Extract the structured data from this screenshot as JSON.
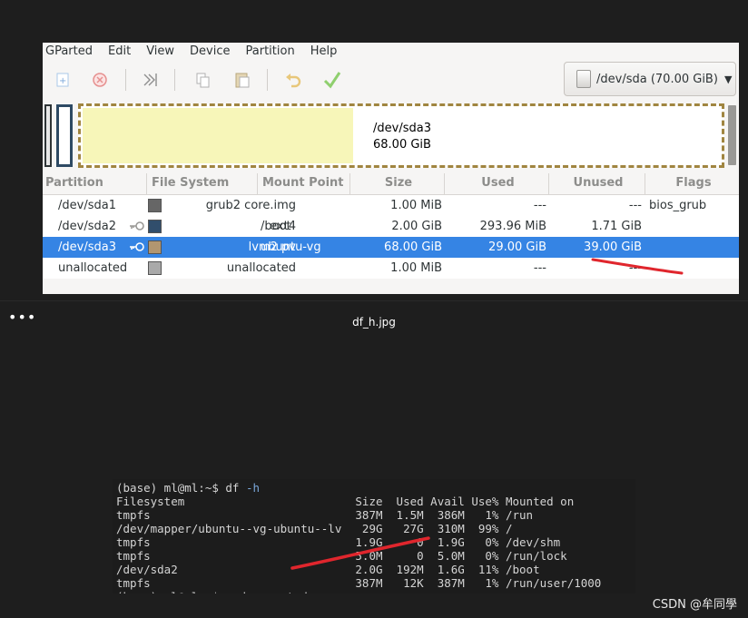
{
  "menu": [
    "GParted",
    "Edit",
    "View",
    "Device",
    "Partition",
    "Help"
  ],
  "toolbar": {
    "new": "new-partition-icon",
    "delete": "delete-icon",
    "resize": "resize-move-icon",
    "copy": "copy-icon",
    "paste": "paste-icon",
    "undo": "undo-icon",
    "apply": "apply-checkmark-icon"
  },
  "device_selector": {
    "label": "/dev/sda (70.00 GiB)",
    "icon": "disk-icon"
  },
  "graph": {
    "name": "/dev/sda3",
    "size": "68.00 GiB",
    "fill_fraction": 0.426
  },
  "table": {
    "headers": [
      "Partition",
      "File System",
      "Mount Point",
      "Size",
      "Used",
      "Unused",
      "Flags"
    ],
    "rows": [
      {
        "partition": "/dev/sda1",
        "fs": "grub2 core.img",
        "mount": "",
        "size": "1.00 MiB",
        "used": "---",
        "unused": "---",
        "flags": "bios_grub",
        "color": "#666666",
        "key": false
      },
      {
        "partition": "/dev/sda2",
        "fs": "ext4",
        "mount": "/boot",
        "size": "2.00 GiB",
        "used": "293.96 MiB",
        "unused": "1.71 GiB",
        "flags": "",
        "color": "#314e6c",
        "key": true
      },
      {
        "partition": "/dev/sda3",
        "fs": "lvm2 pv",
        "mount": "ubuntu-vg",
        "size": "68.00 GiB",
        "used": "29.00 GiB",
        "unused": "39.00 GiB",
        "flags": "",
        "color": "#b29670",
        "key": true
      },
      {
        "partition": "unallocated",
        "fs": "unallocated",
        "mount": "",
        "size": "1.00 MiB",
        "used": "---",
        "unused": "---",
        "flags": "",
        "color": "#a9a9a9",
        "key": false
      }
    ],
    "selected_row": 2
  },
  "viewer": {
    "more": "•••",
    "filename": "df_h.jpg"
  },
  "terminal": {
    "prompt": "(base) ml@ml:~$ df ",
    "flag": "-h",
    "lines": [
      "Filesystem                         Size  Used Avail Use% Mounted on",
      "tmpfs                              387M  1.5M  386M   1% /run",
      "/dev/mapper/ubuntu--vg-ubuntu--lv   29G   27G  310M  99% /",
      "tmpfs                              1.9G     0  1.9G   0% /dev/shm",
      "tmpfs                              5.0M     0  5.0M   0% /run/lock",
      "/dev/sda2                          2.0G  192M  1.6G  11% /boot",
      "tmpfs                              387M   12K  387M   1% /run/user/1000",
      "(base) ml@ml:~$ sudo gparted"
    ]
  },
  "watermark": "CSDN @牟同學",
  "colors": {
    "selection": "#3584e4",
    "annotation": "#e0262d",
    "graph_fill": "#f7f6b9"
  }
}
